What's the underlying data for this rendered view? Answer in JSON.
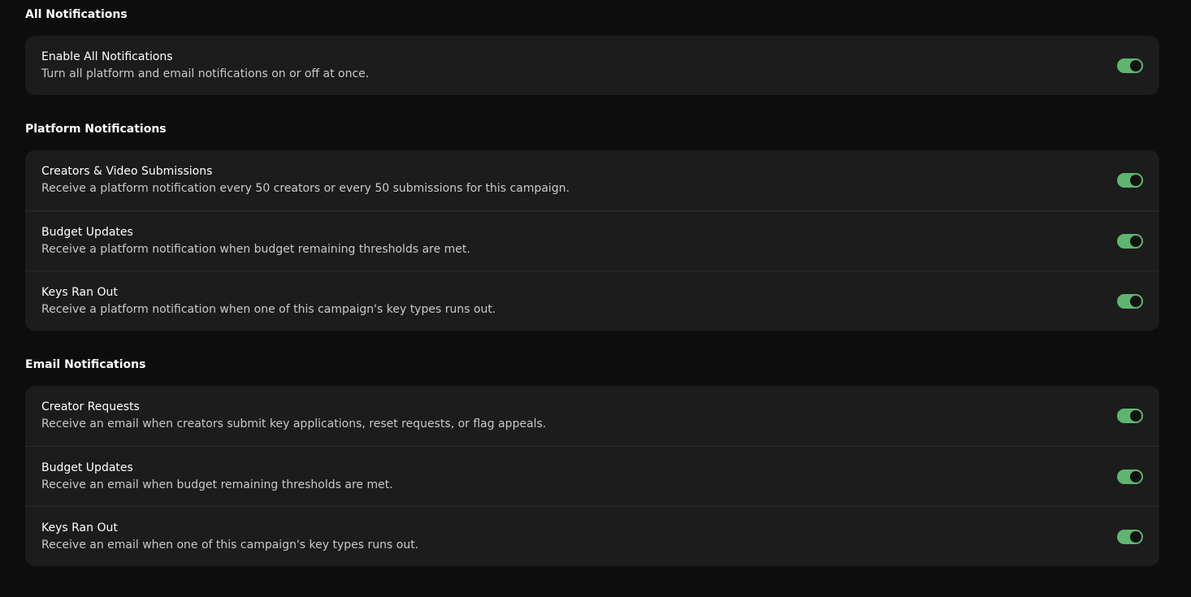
{
  "sections": [
    {
      "title": "All Notifications",
      "items": [
        {
          "label": "Enable All Notifications",
          "description": "Turn all platform and email notifications on or off at once.",
          "enabled": true
        }
      ]
    },
    {
      "title": "Platform Notifications",
      "items": [
        {
          "label": "Creators & Video Submissions",
          "description": "Receive a platform notification every 50 creators or every 50 submissions for this campaign.",
          "enabled": true
        },
        {
          "label": "Budget Updates",
          "description": "Receive a platform notification when budget remaining thresholds are met.",
          "enabled": true
        },
        {
          "label": "Keys Ran Out",
          "description": "Receive a platform notification when one of this campaign's key types runs out.",
          "enabled": true
        }
      ]
    },
    {
      "title": "Email Notifications",
      "items": [
        {
          "label": "Creator Requests",
          "description": "Receive an email when creators submit key applications, reset requests, or flag appeals.",
          "enabled": true
        },
        {
          "label": "Budget Updates",
          "description": "Receive an email when budget remaining thresholds are met.",
          "enabled": true
        },
        {
          "label": "Keys Ran Out",
          "description": "Receive an email when one of this campaign's key types runs out.",
          "enabled": true
        }
      ]
    }
  ],
  "colors": {
    "background": "#0d0d0d",
    "card": "#1c1c1c",
    "toggle_on": "#5fb56f",
    "knob": "#111111"
  }
}
